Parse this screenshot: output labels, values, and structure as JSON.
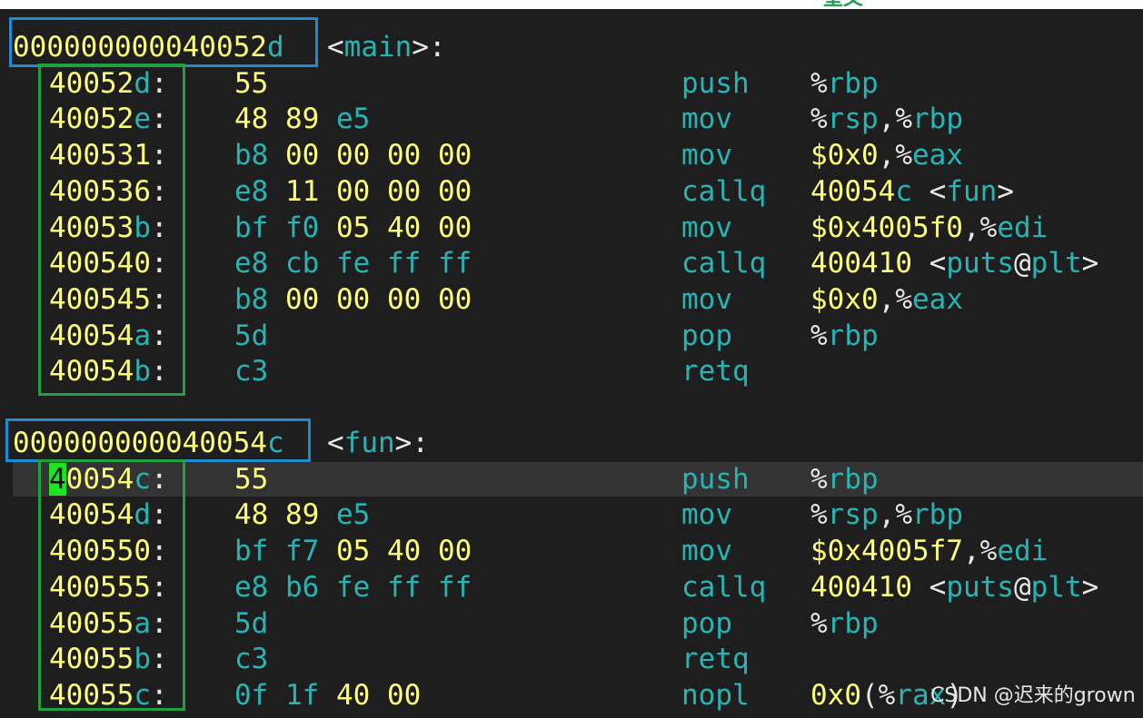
{
  "sections": [
    {
      "symbol_address": {
        "prefix": "00000000004005",
        "suffix": "2d"
      },
      "symbol_name": "main",
      "instructions": [
        {
          "addr_hex": "40052",
          "addr_tail": "d",
          "bytes": [
            "55"
          ],
          "mnemonic": "push",
          "operands": [
            [
              "%",
              "w"
            ],
            [
              "rbp",
              "t"
            ]
          ]
        },
        {
          "addr_hex": "40052",
          "addr_tail": "e",
          "bytes": [
            "48",
            "89",
            "e5"
          ],
          "mnemonic": "mov",
          "operands": [
            [
              "%",
              "w"
            ],
            [
              "rsp",
              "t"
            ],
            [
              ",",
              "w"
            ],
            [
              "%",
              "w"
            ],
            [
              "rbp",
              "t"
            ]
          ]
        },
        {
          "addr_hex": "400531",
          "addr_tail": "",
          "bytes": [
            "b8",
            "00",
            "00",
            "00",
            "00"
          ],
          "mnemonic": "mov",
          "operands": [
            [
              "$0x0",
              "y"
            ],
            [
              ",",
              "w"
            ],
            [
              "%",
              "w"
            ],
            [
              "eax",
              "t"
            ]
          ]
        },
        {
          "addr_hex": "400536",
          "addr_tail": "",
          "bytes": [
            "e8",
            "11",
            "00",
            "00",
            "00"
          ],
          "mnemonic": "callq",
          "operands": [
            [
              "40054",
              "y"
            ],
            [
              "c",
              "t"
            ],
            [
              " <",
              "w"
            ],
            [
              "fun",
              "t"
            ],
            [
              ">",
              "w"
            ]
          ]
        },
        {
          "addr_hex": "40053",
          "addr_tail": "b",
          "bytes": [
            "bf",
            "f0",
            "05",
            "40",
            "00"
          ],
          "mnemonic": "mov",
          "operands": [
            [
              "$0x4005f0",
              "y"
            ],
            [
              ",",
              "w"
            ],
            [
              "%",
              "w"
            ],
            [
              "edi",
              "t"
            ]
          ]
        },
        {
          "addr_hex": "400540",
          "addr_tail": "",
          "bytes": [
            "e8",
            "cb",
            "fe",
            "ff",
            "ff"
          ],
          "mnemonic": "callq",
          "operands": [
            [
              "400410",
              "y"
            ],
            [
              " <",
              "w"
            ],
            [
              "puts",
              "t"
            ],
            [
              "@",
              "w"
            ],
            [
              "plt",
              "t"
            ],
            [
              ">",
              "w"
            ]
          ]
        },
        {
          "addr_hex": "400545",
          "addr_tail": "",
          "bytes": [
            "b8",
            "00",
            "00",
            "00",
            "00"
          ],
          "mnemonic": "mov",
          "operands": [
            [
              "$0x0",
              "y"
            ],
            [
              ",",
              "w"
            ],
            [
              "%",
              "w"
            ],
            [
              "eax",
              "t"
            ]
          ]
        },
        {
          "addr_hex": "40054",
          "addr_tail": "a",
          "bytes": [
            "5d"
          ],
          "mnemonic": "pop",
          "operands": [
            [
              "%",
              "w"
            ],
            [
              "rbp",
              "t"
            ]
          ]
        },
        {
          "addr_hex": "40054",
          "addr_tail": "b",
          "bytes": [
            "c3"
          ],
          "mnemonic": "retq",
          "operands": []
        }
      ]
    },
    {
      "symbol_address": {
        "prefix": "00000000004005",
        "suffix": "4c"
      },
      "symbol_name": "fun",
      "instructions": [
        {
          "addr_hex": "40054",
          "addr_tail": "c",
          "bytes": [
            "55"
          ],
          "mnemonic": "push",
          "operands": [
            [
              "%",
              "w"
            ],
            [
              "rbp",
              "t"
            ]
          ],
          "current": true
        },
        {
          "addr_hex": "40054",
          "addr_tail": "d",
          "bytes": [
            "48",
            "89",
            "e5"
          ],
          "mnemonic": "mov",
          "operands": [
            [
              "%",
              "w"
            ],
            [
              "rsp",
              "t"
            ],
            [
              ",",
              "w"
            ],
            [
              "%",
              "w"
            ],
            [
              "rbp",
              "t"
            ]
          ]
        },
        {
          "addr_hex": "400550",
          "addr_tail": "",
          "bytes": [
            "bf",
            "f7",
            "05",
            "40",
            "00"
          ],
          "mnemonic": "mov",
          "operands": [
            [
              "$0x4005f7",
              "y"
            ],
            [
              ",",
              "w"
            ],
            [
              "%",
              "w"
            ],
            [
              "edi",
              "t"
            ]
          ]
        },
        {
          "addr_hex": "400555",
          "addr_tail": "",
          "bytes": [
            "e8",
            "b6",
            "fe",
            "ff",
            "ff"
          ],
          "mnemonic": "callq",
          "operands": [
            [
              "400410",
              "y"
            ],
            [
              " <",
              "w"
            ],
            [
              "puts",
              "t"
            ],
            [
              "@",
              "w"
            ],
            [
              "plt",
              "t"
            ],
            [
              ">",
              "w"
            ]
          ]
        },
        {
          "addr_hex": "40055",
          "addr_tail": "a",
          "bytes": [
            "5d"
          ],
          "mnemonic": "pop",
          "operands": [
            [
              "%",
              "w"
            ],
            [
              "rbp",
              "t"
            ]
          ]
        },
        {
          "addr_hex": "40055",
          "addr_tail": "b",
          "bytes": [
            "c3"
          ],
          "mnemonic": "retq",
          "operands": []
        },
        {
          "addr_hex": "40055",
          "addr_tail": "c",
          "bytes": [
            "0f",
            "1f",
            "40",
            "00"
          ],
          "mnemonic": "nopl",
          "operands": [
            [
              "0x0",
              "y"
            ],
            [
              "(",
              "w"
            ],
            [
              "%",
              "w"
            ],
            [
              "rax",
              "t"
            ],
            [
              ")",
              "w"
            ]
          ]
        }
      ]
    }
  ],
  "watermark": "CSDN @迟来的grown",
  "colors": {
    "background": "#1e1e1e",
    "address": "#ffff7a",
    "keyword": "#28b4b4",
    "symbol_box": "#1e8ccf",
    "address_box": "#20a040",
    "cursor": "#22e022",
    "current_line": "#333333"
  }
}
